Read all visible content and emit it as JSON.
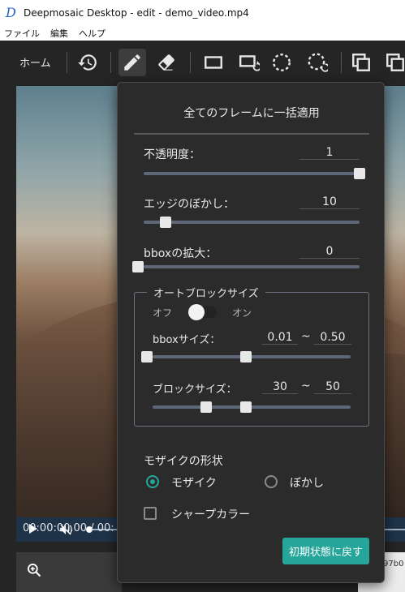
{
  "window": {
    "title": "Deepmosaic Desktop - edit - demo_video.mp4"
  },
  "menu": {
    "items": [
      "ファイル",
      "編集",
      "ヘルプ"
    ]
  },
  "toolbar": {
    "home_label": "ホーム",
    "tools": [
      "history-icon",
      "pencil-icon",
      "eraser-icon",
      "rectangle-icon",
      "rectangle-propagate-icon",
      "ellipse-icon",
      "ellipse-propagate-icon",
      "copy-icon",
      "copy-all-icon"
    ],
    "active_tool": "pencil-icon"
  },
  "player": {
    "timecode": "00:00:00.00 / 00:",
    "thumbnail_fragment": "97b0",
    "progress": 0.0
  },
  "popup": {
    "title": "全てのフレームに一括適用",
    "opacity": {
      "label": "不透明度：",
      "value": "1",
      "slider_fraction": 1.0
    },
    "edge_blur": {
      "label": "エッジのぼかし：",
      "value": "10",
      "slider_fraction": 0.1
    },
    "bbox_expand": {
      "label": "bboxの拡大：",
      "value": "0",
      "slider_fraction": 0.0
    },
    "auto_block": {
      "legend": "オートブロックサイズ",
      "toggle_off_label": "オフ",
      "toggle_on_label": "オン",
      "toggle_state": "off",
      "bbox_size_label": "bboxサイズ：",
      "bbox_min": "0.01",
      "bbox_max": "0.50",
      "range_sep": "~",
      "bbox_min_fraction": 0.0,
      "bbox_max_fraction": 0.5,
      "block_size_label": "ブロックサイズ：",
      "block_min": "30",
      "block_max": "50",
      "block_min_fraction": 0.3,
      "block_max_fraction": 0.5
    },
    "shape": {
      "label": "モザイクの形状",
      "options": [
        "モザイク",
        "ぼかし"
      ],
      "selected": "モザイク"
    },
    "sharp_color_label": "シャープカラー",
    "sharp_color_checked": false,
    "reset_label": "初期状態に戻す"
  },
  "colors": {
    "accent": "#26a69a",
    "panel_bg": "#2b2b2b",
    "app_bg": "#252525",
    "track": "#5d6778",
    "video_bar": "#1f3348"
  }
}
